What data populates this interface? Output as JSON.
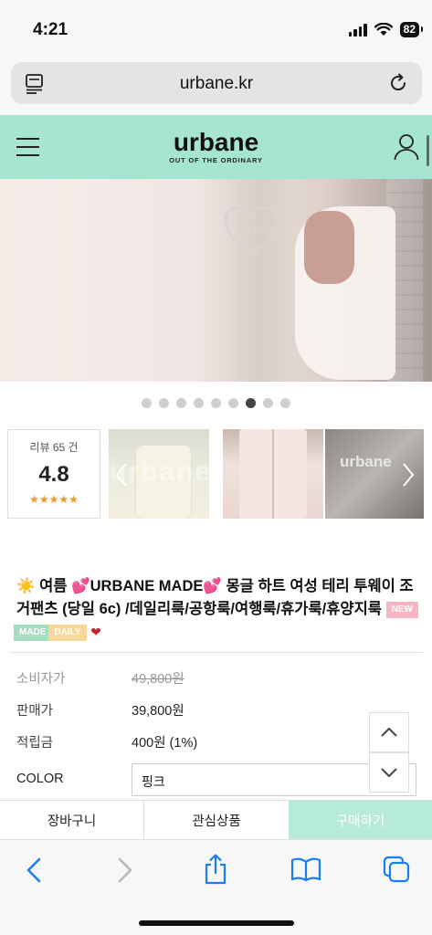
{
  "status_bar": {
    "time": "4:21",
    "battery": "82"
  },
  "browser": {
    "url": "urbane.kr"
  },
  "site": {
    "logo": "urbane",
    "tagline": "OUT OF THE ORDINARY"
  },
  "gallery": {
    "dot_count": 9,
    "active_index": 6
  },
  "review": {
    "count_text": "리뷰 65 건",
    "score": "4.8",
    "stars": "★★★★★",
    "rating": 5
  },
  "thumbnails": {
    "watermark": "urbane",
    "brand_text": "urbane"
  },
  "product": {
    "title_prefix": "☀️ 여름 💕URBANE MADE💕 몽글 하트 여성 테리 투웨이 조거팬츠 (당일 6c) /데일리룩/공항룩/여행룩/휴가룩/휴양지룩",
    "badges": [
      "NEW",
      "MADE",
      "DAILY"
    ],
    "heart": "❤"
  },
  "prices": {
    "consumer_label": "소비자가",
    "consumer_value": "49,800원",
    "sale_label": "판매가",
    "sale_value": "39,800원",
    "points_label": "적립금",
    "points_value": "400원 (1%)",
    "color_label": "COLOR",
    "color_value": "핑크"
  },
  "actions": {
    "cart": "장바구니",
    "wishlist": "관심상품",
    "buy": "구매하기"
  },
  "colors": {
    "header_mint": "#a6e5d2",
    "buy_button": "#b6ebd9",
    "ios_blue": "#1a7ef5",
    "star": "#f09a2a"
  }
}
